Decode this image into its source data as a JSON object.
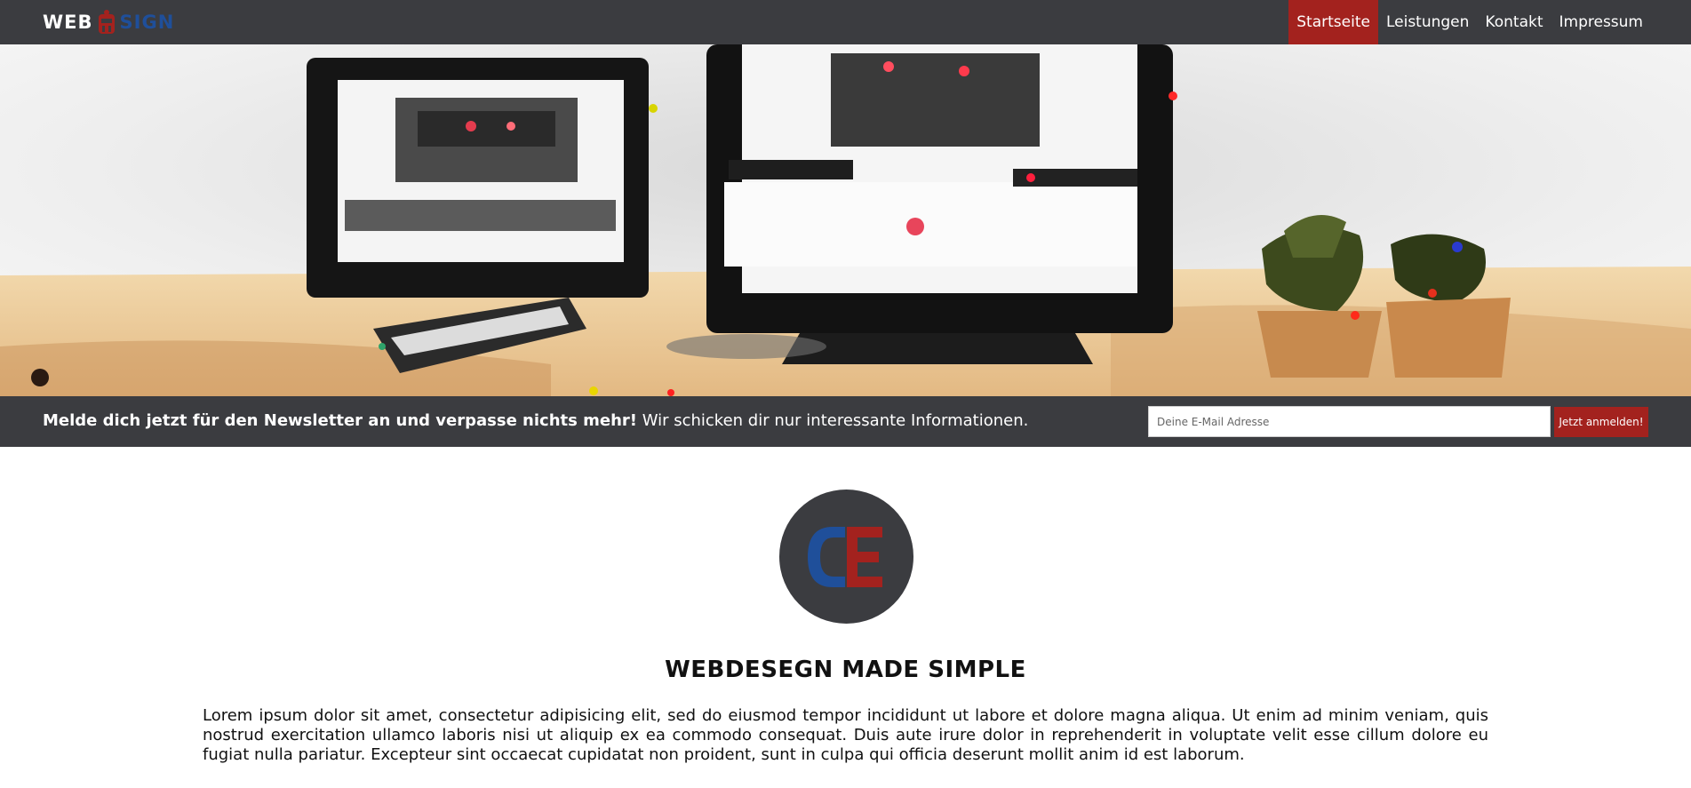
{
  "header": {
    "logo": {
      "part1": "WEB",
      "part2": "SIGN",
      "icon": "robot-logo-icon"
    },
    "nav": [
      {
        "label": "Startseite",
        "active": true
      },
      {
        "label": "Leistungen",
        "active": false
      },
      {
        "label": "Kontakt",
        "active": false
      },
      {
        "label": "Impressum",
        "active": false
      }
    ]
  },
  "hero": {
    "icon": "workspace-illustration"
  },
  "newsletter": {
    "bold_text": "Melde dich jetzt für den Newsletter an und verpasse nichts mehr!",
    "text": " Wir schicken dir nur interessante Informationen.",
    "email_placeholder": "Deine E-Mail Adresse",
    "button_label": "Jetzt anmelden!"
  },
  "main": {
    "badge_icon": "de-monogram-logo",
    "headline": "WEBDESEGN MADE SIMPLE",
    "body": "Lorem ipsum dolor sit amet, consectetur adipisicing elit, sed do eiusmod tempor incididunt ut labore et dolore magna aliqua. Ut enim ad minim veniam, quis nostrud exercitation ullamco laboris nisi ut aliquip ex ea commodo consequat. Duis aute irure dolor in reprehenderit in voluptate velit esse cillum dolore eu fugiat nulla pariatur. Excepteur sint occaecat cupidatat non proident, sunt in culpa qui officia deserunt mollit anim id est laborum."
  },
  "colors": {
    "dark": "#3b3c40",
    "accent": "#a3221e",
    "blue": "#1f4f9a"
  }
}
